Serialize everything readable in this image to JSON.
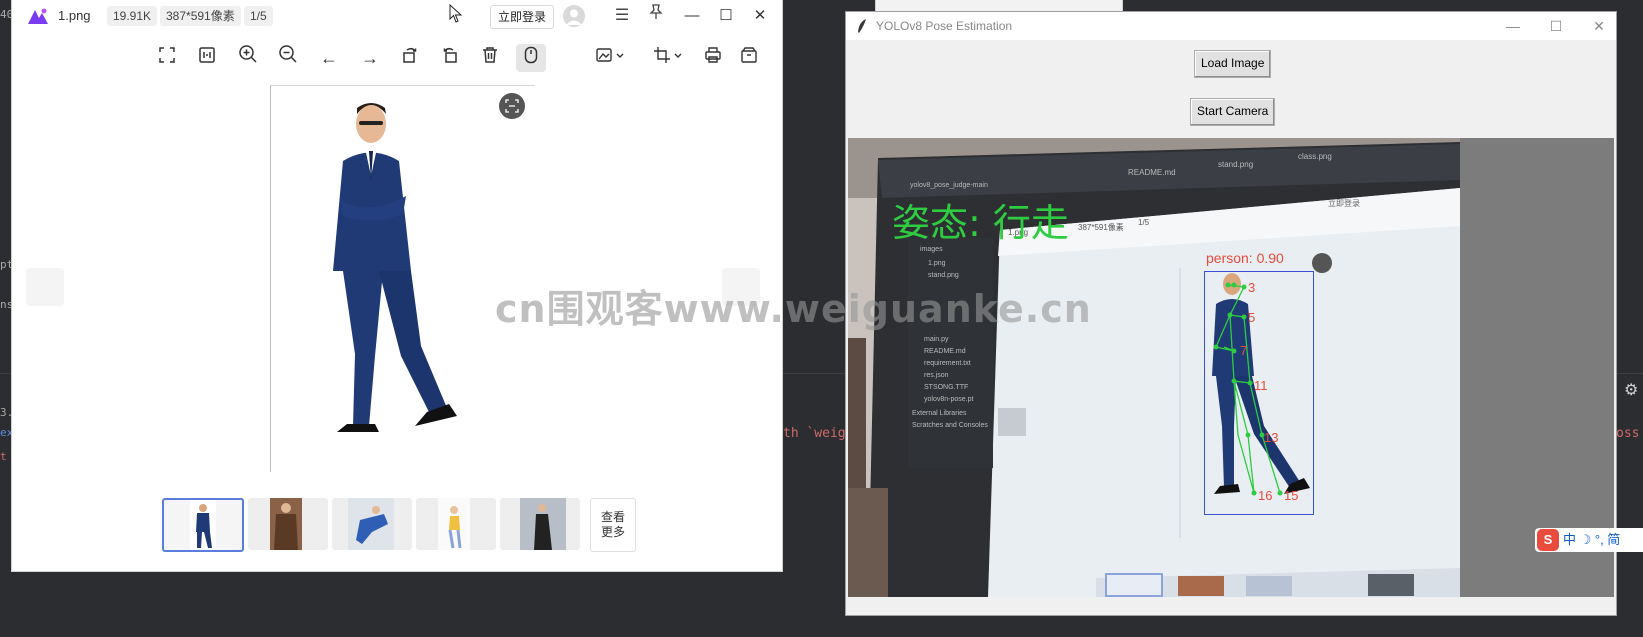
{
  "viewer": {
    "file_name": "1.png",
    "file_size": "19.91K",
    "dimensions": "387*591像素",
    "page_index": "1/5",
    "login_label": "立即登录",
    "more_label_line1": "查看",
    "more_label_line2": "更多",
    "toolbar_icons": [
      "fullscreen-icon",
      "fit-icon",
      "zoom-in-icon",
      "zoom-out-icon",
      "prev-icon",
      "next-icon",
      "rotate-left-icon",
      "rotate-right-icon",
      "delete-icon",
      "mouse-icon",
      "edit-image-icon",
      "crop-icon",
      "print-icon",
      "save-icon"
    ],
    "thumbnails": [
      "thumb-1",
      "thumb-2",
      "thumb-3",
      "thumb-4",
      "thumb-5"
    ]
  },
  "pose": {
    "title": "YOLOv8 Pose Estimation",
    "load_label": "Load Image",
    "camera_label": "Start Camera",
    "posture_text": "姿态: 行走",
    "detection_label": "person: 0.90",
    "keypoint_labels": [
      "3",
      "5",
      "7",
      "11",
      "13",
      "16",
      "15"
    ]
  },
  "inner_screen": {
    "file_name": "1.png",
    "dimensions": "387*591像素",
    "page_index": "1/5",
    "login_label": "立即登录",
    "project_items": [
      "yolov8_pose_judge-main",
      "images",
      "1.png",
      "stand.png",
      "main.py",
      "README.md",
      "requirement.txt",
      "res.json",
      "STSONG.TTF",
      "yolov8n-pose.pt",
      "External Libraries",
      "Scratches and Consoles"
    ],
    "tabs": [
      "README.md",
      "stand.png",
      "class.png"
    ]
  },
  "ime": {
    "logo": "S",
    "text": "中 ☽ °, 简"
  },
  "watermark": "cn围观客www.weiguanke.cn",
  "ide": {
    "line_1": "th `weig",
    "line_2": "oss",
    "left_letters": [
      "40",
      "pt",
      "ns",
      "3.",
      "ex",
      "t"
    ]
  },
  "colors": {
    "accent": "#5a7de0",
    "pose_green": "#2ecc40",
    "box_blue": "#3b4fd8",
    "label_red": "#e74c3c"
  }
}
